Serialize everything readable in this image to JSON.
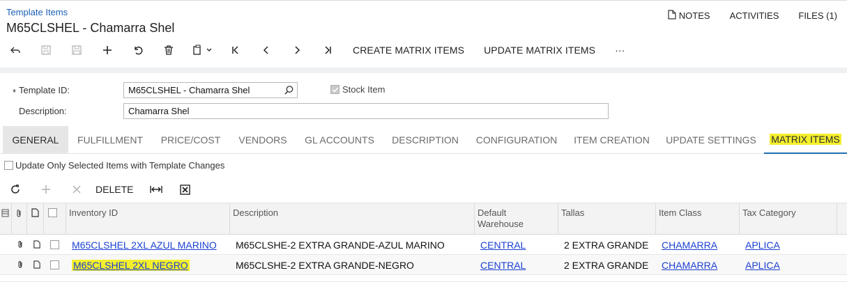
{
  "header": {
    "breadcrumb": "Template Items",
    "title": "M65CLSHEL - Chamarra Shel",
    "links": {
      "notes": "NOTES",
      "activities": "ACTIVITIES",
      "files": "FILES (1)"
    }
  },
  "toolbar": {
    "create_matrix": "CREATE MATRIX ITEMS",
    "update_matrix": "UPDATE MATRIX ITEMS",
    "more": "···"
  },
  "form": {
    "template_id_label": "Template ID:",
    "template_id_value": "M65CLSHEL - Chamarra Shel",
    "description_label": "Description:",
    "description_value": "Chamarra Shel",
    "stock_item_label": "Stock Item",
    "stock_item_checked": true,
    "required_mark": "*"
  },
  "tabs": [
    {
      "label": "GENERAL"
    },
    {
      "label": "FULFILLMENT"
    },
    {
      "label": "PRICE/COST"
    },
    {
      "label": "VENDORS"
    },
    {
      "label": "GL ACCOUNTS"
    },
    {
      "label": "DESCRIPTION"
    },
    {
      "label": "CONFIGURATION"
    },
    {
      "label": "ITEM CREATION"
    },
    {
      "label": "UPDATE SETTINGS"
    },
    {
      "label": "MATRIX ITEMS"
    }
  ],
  "update_only": "Update Only Selected Items with Template Changes",
  "grid_toolbar": {
    "delete": "DELETE"
  },
  "grid": {
    "headers": {
      "inventory_id": "Inventory ID",
      "description": "Description",
      "default_warehouse_1": "Default",
      "default_warehouse_2": "Warehouse",
      "tallas": "Tallas",
      "item_class": "Item Class",
      "tax_category": "Tax Category"
    },
    "rows": [
      {
        "inventory_id": "M65CLSHEL 2XL AZUL MARINO",
        "description": "M65CLSHE-2 EXTRA GRANDE-AZUL MARINO",
        "warehouse": "CENTRAL",
        "tallas": "2 EXTRA GRANDE",
        "item_class": "CHAMARRA",
        "tax_category": "APLICA"
      },
      {
        "inventory_id": "M65CLSHEL 2XL NEGRO",
        "description": "M65CLSHE-2 EXTRA GRANDE-NEGRO",
        "warehouse": "CENTRAL",
        "tallas": "2 EXTRA GRANDE",
        "item_class": "CHAMARRA",
        "tax_category": "APLICA"
      }
    ]
  },
  "colors": {
    "link": "#1a3fd0",
    "highlight": "#f4ef2d",
    "active_tab_underline": "#1f6fb2"
  }
}
